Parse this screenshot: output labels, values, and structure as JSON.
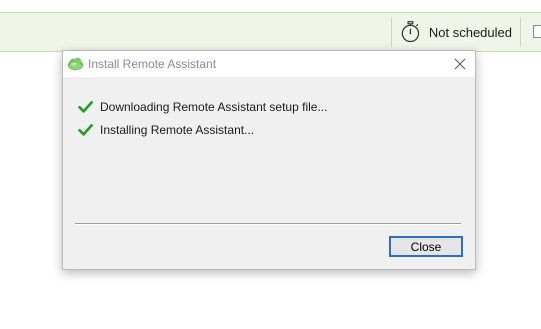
{
  "toolbar": {
    "schedule_label": "Not scheduled",
    "schedule_icon": "stopwatch-icon"
  },
  "dialog": {
    "title": "Install Remote Assistant",
    "app_icon": "remote-assistant-cloud-icon",
    "steps": [
      {
        "label": "Downloading Remote Assistant setup file...",
        "status": "done",
        "icon": "green-checkmark-icon"
      },
      {
        "label": "Installing Remote Assistant...",
        "status": "done",
        "icon": "green-checkmark-icon"
      }
    ],
    "close_button_label": "Close"
  },
  "colors": {
    "toolbar_bg": "#eff6e9",
    "toolbar_border": "#c4deb0",
    "check_green": "#1f9e1f",
    "button_focus_border": "#2a6fc9"
  }
}
